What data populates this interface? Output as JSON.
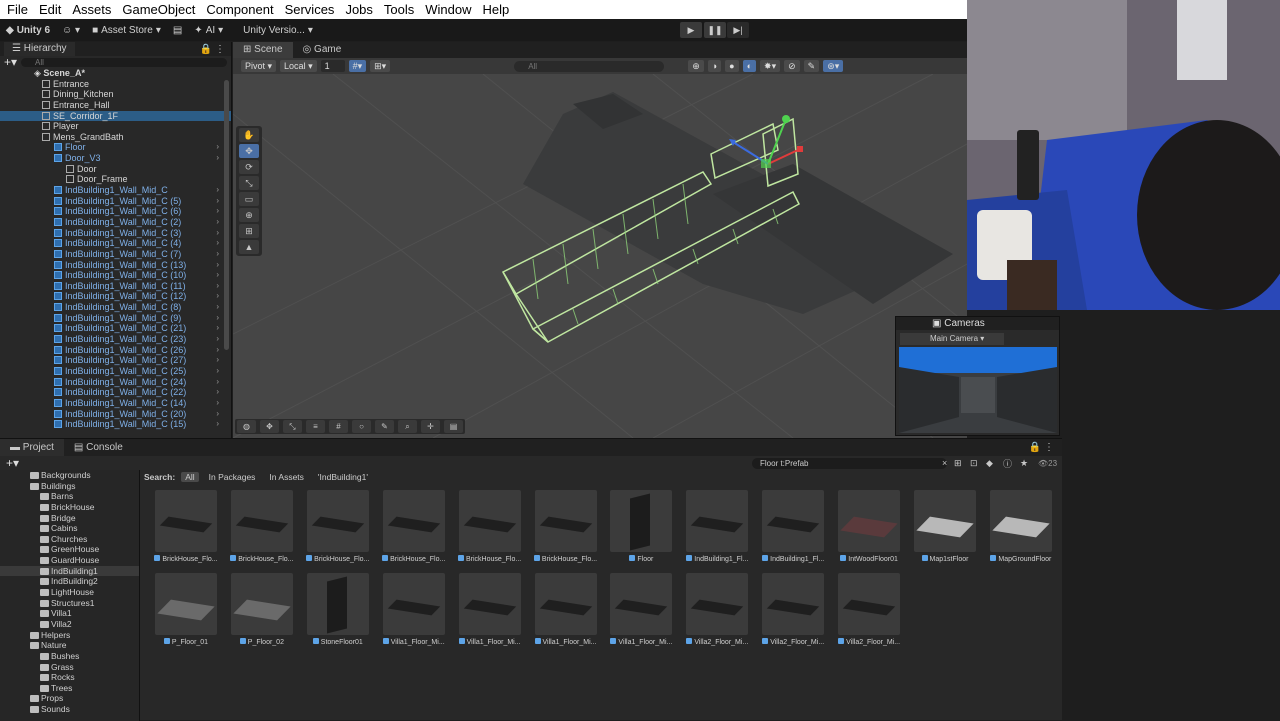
{
  "menu": [
    "File",
    "Edit",
    "Assets",
    "GameObject",
    "Component",
    "Services",
    "Jobs",
    "Tools",
    "Window",
    "Help"
  ],
  "toolbar": {
    "unity": "Unity 6",
    "store": "Asset Store",
    "ai": "AI",
    "version": "Unity Versio..."
  },
  "hierarchy": {
    "title": "Hierarchy",
    "search_placeholder": "All",
    "scene": "Scene_A*",
    "items": [
      {
        "label": "Entrance",
        "indent": 1
      },
      {
        "label": "Dining_Kitchen",
        "indent": 1
      },
      {
        "label": "Entrance_Hall",
        "indent": 1
      },
      {
        "label": "SE_Corridor_1F",
        "indent": 1,
        "sel": true
      },
      {
        "label": "Player",
        "indent": 1
      },
      {
        "label": "Mens_GrandBath",
        "indent": 1
      },
      {
        "label": "Floor",
        "indent": 2,
        "blue": true
      },
      {
        "label": "Door_V3",
        "indent": 2,
        "blue": true
      },
      {
        "label": "Door",
        "indent": 3
      },
      {
        "label": "Door_Frame",
        "indent": 3
      },
      {
        "label": "IndBuilding1_Wall_Mid_C",
        "indent": 2,
        "blue": true
      },
      {
        "label": "IndBuilding1_Wall_Mid_C (5)",
        "indent": 2,
        "blue": true
      },
      {
        "label": "IndBuilding1_Wall_Mid_C (6)",
        "indent": 2,
        "blue": true
      },
      {
        "label": "IndBuilding1_Wall_Mid_C (2)",
        "indent": 2,
        "blue": true
      },
      {
        "label": "IndBuilding1_Wall_Mid_C (3)",
        "indent": 2,
        "blue": true
      },
      {
        "label": "IndBuilding1_Wall_Mid_C (4)",
        "indent": 2,
        "blue": true
      },
      {
        "label": "IndBuilding1_Wall_Mid_C (7)",
        "indent": 2,
        "blue": true
      },
      {
        "label": "IndBuilding1_Wall_Mid_C (13)",
        "indent": 2,
        "blue": true
      },
      {
        "label": "IndBuilding1_Wall_Mid_C (10)",
        "indent": 2,
        "blue": true
      },
      {
        "label": "IndBuilding1_Wall_Mid_C (11)",
        "indent": 2,
        "blue": true
      },
      {
        "label": "IndBuilding1_Wall_Mid_C (12)",
        "indent": 2,
        "blue": true
      },
      {
        "label": "IndBuilding1_Wall_Mid_C (8)",
        "indent": 2,
        "blue": true
      },
      {
        "label": "IndBuilding1_Wall_Mid_C (9)",
        "indent": 2,
        "blue": true
      },
      {
        "label": "IndBuilding1_Wall_Mid_C (21)",
        "indent": 2,
        "blue": true
      },
      {
        "label": "IndBuilding1_Wall_Mid_C (23)",
        "indent": 2,
        "blue": true
      },
      {
        "label": "IndBuilding1_Wall_Mid_C (26)",
        "indent": 2,
        "blue": true
      },
      {
        "label": "IndBuilding1_Wall_Mid_C (27)",
        "indent": 2,
        "blue": true
      },
      {
        "label": "IndBuilding1_Wall_Mid_C (25)",
        "indent": 2,
        "blue": true
      },
      {
        "label": "IndBuilding1_Wall_Mid_C (24)",
        "indent": 2,
        "blue": true
      },
      {
        "label": "IndBuilding1_Wall_Mid_C (22)",
        "indent": 2,
        "blue": true
      },
      {
        "label": "IndBuilding1_Wall_Mid_C (14)",
        "indent": 2,
        "blue": true
      },
      {
        "label": "IndBuilding1_Wall_Mid_C (20)",
        "indent": 2,
        "blue": true
      },
      {
        "label": "IndBuilding1_Wall_Mid_C (15)",
        "indent": 2,
        "blue": true
      }
    ]
  },
  "scene": {
    "tab_scene": "Scene",
    "tab_game": "Game",
    "pivot": "Pivot",
    "local": "Local",
    "grid_snap": "1",
    "search_placeholder": "All"
  },
  "cameras": {
    "title": "Cameras",
    "selected": "Main Camera"
  },
  "project": {
    "tab_project": "Project",
    "tab_console": "Console",
    "search_value": "Floor t:Prefab",
    "count": "23",
    "search_label": "Search:",
    "filter_all": "All",
    "filter_packages": "In Packages",
    "filter_assets": "In Assets",
    "filter_folder": "'IndBuilding1'",
    "tree": [
      {
        "label": "Backgrounds",
        "indent": 1
      },
      {
        "label": "Buildings",
        "indent": 1
      },
      {
        "label": "Barns",
        "indent": 2
      },
      {
        "label": "BrickHouse",
        "indent": 2
      },
      {
        "label": "Bridge",
        "indent": 2
      },
      {
        "label": "Cabins",
        "indent": 2
      },
      {
        "label": "Churches",
        "indent": 2
      },
      {
        "label": "GreenHouse",
        "indent": 2
      },
      {
        "label": "GuardHouse",
        "indent": 2
      },
      {
        "label": "IndBuilding1",
        "indent": 2,
        "sel": true
      },
      {
        "label": "IndBuilding2",
        "indent": 2
      },
      {
        "label": "LightHouse",
        "indent": 2
      },
      {
        "label": "Structures1",
        "indent": 2
      },
      {
        "label": "Villa1",
        "indent": 2
      },
      {
        "label": "Villa2",
        "indent": 2
      },
      {
        "label": "Helpers",
        "indent": 1
      },
      {
        "label": "Nature",
        "indent": 1
      },
      {
        "label": "Bushes",
        "indent": 2
      },
      {
        "label": "Grass",
        "indent": 2
      },
      {
        "label": "Rocks",
        "indent": 2
      },
      {
        "label": "Trees",
        "indent": 2
      },
      {
        "label": "Props",
        "indent": 1
      },
      {
        "label": "Sounds",
        "indent": 1
      }
    ],
    "assets": [
      {
        "label": "BrickHouse_Flo...",
        "style": "dark"
      },
      {
        "label": "BrickHouse_Flo...",
        "style": "dark"
      },
      {
        "label": "BrickHouse_Flo...",
        "style": "dark"
      },
      {
        "label": "BrickHouse_Flo...",
        "style": "dark"
      },
      {
        "label": "BrickHouse_Flo...",
        "style": "dark"
      },
      {
        "label": "BrickHouse_Flo...",
        "style": "dark"
      },
      {
        "label": "Floor",
        "style": "wall"
      },
      {
        "label": "IndBuilding1_Fl...",
        "style": "dark"
      },
      {
        "label": "IndBuilding1_Fl...",
        "style": "dark"
      },
      {
        "label": "IntWoodFloor01",
        "style": "wood"
      },
      {
        "label": "Map1stFloor",
        "style": "light"
      },
      {
        "label": "MapGroundFloor",
        "style": "light"
      },
      {
        "label": "P_Floor_01",
        "style": "grey"
      },
      {
        "label": "P_Floor_02",
        "style": "grey"
      },
      {
        "label": "StoneFloor01",
        "style": "wall"
      },
      {
        "label": "Villa1_Floor_Mi...",
        "style": "dark"
      },
      {
        "label": "Villa1_Floor_Mi...",
        "style": "dark"
      },
      {
        "label": "Villa1_Floor_Mi...",
        "style": "dark"
      },
      {
        "label": "Villa1_Floor_Mi...",
        "style": "dark"
      },
      {
        "label": "Villa2_Floor_Mi...",
        "style": "dark"
      },
      {
        "label": "Villa2_Floor_Mi...",
        "style": "dark"
      },
      {
        "label": "Villa2_Floor_Mi...",
        "style": "dark"
      }
    ]
  }
}
